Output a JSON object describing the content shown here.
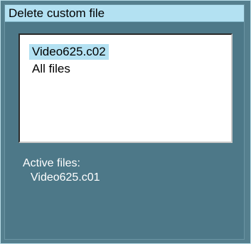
{
  "dialog": {
    "title": "Delete custom file",
    "list": {
      "items": [
        {
          "label": "Video625.c02",
          "selected": true
        },
        {
          "label": "All files",
          "selected": false
        }
      ]
    },
    "active_files": {
      "label": "Active files:",
      "files": [
        "Video625.c01"
      ]
    }
  },
  "colors": {
    "dialog_background": "#557f8e",
    "title_bar": "#b3e1f2",
    "selection_highlight": "#b3e1f2",
    "list_background": "#ffffff",
    "status_text": "#ffffff"
  }
}
